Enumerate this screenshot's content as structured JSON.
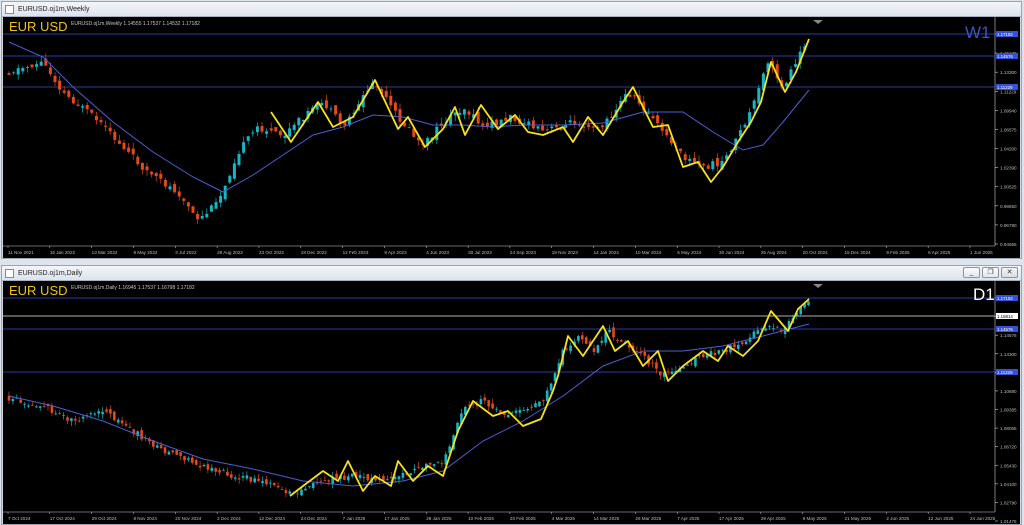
{
  "windows": [
    {
      "title": "EURUSD.oj1m,Weekly",
      "symbol": "EUR USD",
      "ohlc": "EURUSD.oj1m,Weekly  1.14555 1.17537 1.14532 1.17182",
      "timeframe": "W1",
      "price_labels": [
        "1.17182",
        "1.15176",
        "1.13300",
        "1.11229",
        "1.09940",
        "1.06575",
        "1.04200",
        "1.02390",
        "1.00525",
        "0.98650",
        "0.96780",
        "0.94665"
      ],
      "hlines": [
        "1.17182",
        "1.14576",
        "1.11229"
      ],
      "dates": [
        "11 Nov 2021",
        "16 Jan 2022",
        "13 Mar 2022",
        "8 May 2022",
        "3 Jul 2022",
        "28 Aug 2022",
        "23 Oct 2022",
        "18 Dec 2022",
        "12 Feb 2023",
        "9 Apr 2023",
        "4 Jun 2023",
        "30 Jul 2023",
        "24 Sep 2023",
        "19 Nov 2023",
        "14 Jan 2024",
        "10 Mar 2024",
        "5 May 2024",
        "30 Jun 2024",
        "25 Aug 2024",
        "20 Oct 2024",
        "15 Dec 2024",
        "9 Feb 2025",
        "6 Apr 2025",
        "1 Jun 2025"
      ]
    },
    {
      "title": "EURUSD.oj1m,Daily",
      "symbol": "EUR USD",
      "ohlc": "EURUSD.oj1m,Daily  1.16945 1.17537 1.16798 1.17182",
      "timeframe": "D1",
      "price_labels": [
        "1.17182",
        "1.15814",
        "1.14576",
        "1.13300",
        "1.12010",
        "1.10680",
        "1.09385",
        "1.08055",
        "1.06720",
        "1.05430",
        "1.04100",
        "1.02790",
        "1.01475"
      ],
      "hlines": [
        "1.17182",
        "1.15814",
        "1.14576",
        "1.11229"
      ],
      "dates": [
        "7 Oct 2024",
        "17 Oct 2024",
        "29 Oct 2024",
        "8 Nov 2024",
        "20 Nov 2024",
        "2 Dec 2024",
        "12 Dec 2024",
        "24 Dec 2024",
        "7 Jan 2025",
        "17 Jan 2025",
        "29 Jan 2025",
        "10 Feb 2025",
        "20 Feb 2025",
        "4 Mar 2025",
        "14 Mar 2025",
        "26 Mar 2025",
        "7 Apr 2025",
        "17 Apr 2025",
        "29 Apr 2025",
        "9 May 2025",
        "21 May 2025",
        "2 Jun 2025",
        "12 Jun 2025",
        "24 Jun 2025"
      ]
    }
  ],
  "colors": {
    "bull": "#19b5c4",
    "bear": "#e3491b",
    "ma": "#4a5fd4",
    "zigzag": "#f6e21a",
    "hline": "#3551d6",
    "bg": "#000000",
    "axis": "#bdbdbd",
    "symbol": "#f2c21b"
  },
  "window_buttons": {
    "minimize": "_",
    "restore": "❐",
    "close": "✕"
  }
}
